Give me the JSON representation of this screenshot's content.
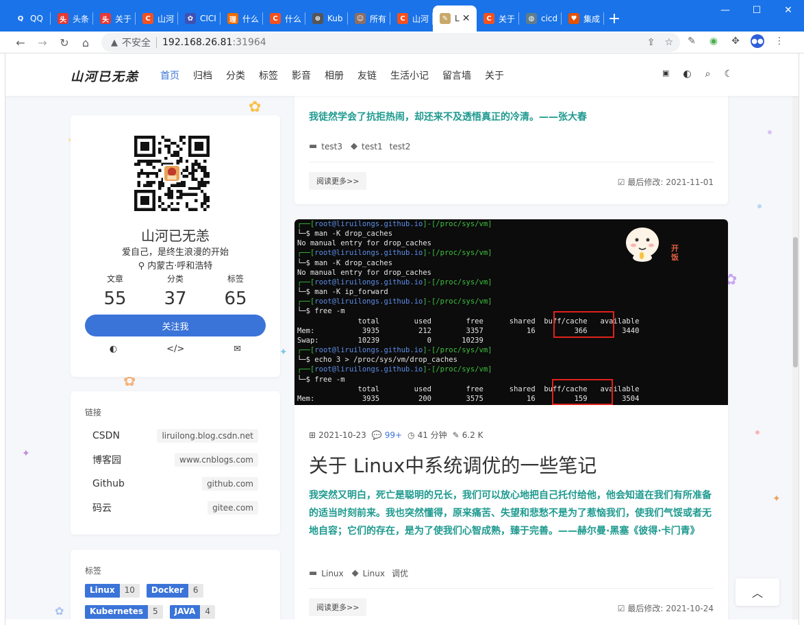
{
  "browser": {
    "tabs": [
      {
        "label": "QQ",
        "color": "#1a73e8",
        "glyph": "Q"
      },
      {
        "label": "头条",
        "color": "#e53935",
        "glyph": "头"
      },
      {
        "label": "关于",
        "color": "#e53935",
        "glyph": "头"
      },
      {
        "label": "山河",
        "color": "#f4511e",
        "glyph": "C"
      },
      {
        "label": "CICI",
        "color": "#3f51b5",
        "glyph": "✿"
      },
      {
        "label": "什么",
        "color": "#ef6c00",
        "glyph": "理"
      },
      {
        "label": "什么",
        "color": "#f4511e",
        "glyph": "C"
      },
      {
        "label": "Kub",
        "color": "#555555",
        "glyph": "⊛"
      },
      {
        "label": "所有",
        "color": "#8d6e63",
        "glyph": "☺"
      },
      {
        "label": "山河",
        "color": "#f4511e",
        "glyph": "C"
      },
      {
        "label": "L",
        "color": "#c9a86a",
        "glyph": "✎"
      },
      {
        "label": "关于",
        "color": "#f4511e",
        "glyph": "C"
      },
      {
        "label": "cicd",
        "color": "#607d8b",
        "glyph": "◍"
      },
      {
        "label": "集成",
        "color": "#e65100",
        "glyph": "♥"
      }
    ],
    "active_tab_index": 10,
    "new_tab": "+",
    "window_controls": {
      "minimize": "—",
      "maximize": "☐",
      "close": "✕"
    },
    "address": {
      "security": "不安全",
      "host": "192.168.26.81",
      "port": ":31964"
    }
  },
  "site": {
    "logo": "山河已无恙",
    "nav": [
      "首页",
      "归档",
      "分类",
      "标签",
      "影音",
      "相册",
      "友链",
      "生活小记",
      "留言墙",
      "关于"
    ],
    "active_nav": "首页"
  },
  "profile": {
    "name": "山河已无恙",
    "motto": "爱自己，是终生浪漫的开始",
    "location": "内蒙古·呼和浩特",
    "stats": [
      {
        "label": "文章",
        "value": "55"
      },
      {
        "label": "分类",
        "value": "37"
      },
      {
        "label": "标签",
        "value": "65"
      }
    ],
    "follow_label": "关注我"
  },
  "links": {
    "title": "链接",
    "items": [
      {
        "name": "CSDN",
        "url": "liruilong.blog.csdn.net"
      },
      {
        "name": "博客园",
        "url": "www.cnblogs.com"
      },
      {
        "name": "Github",
        "url": "github.com"
      },
      {
        "name": "码云",
        "url": "gitee.com"
      }
    ]
  },
  "tags": {
    "title": "标签",
    "items": [
      {
        "name": "Linux",
        "count": "10"
      },
      {
        "name": "Docker",
        "count": "6"
      },
      {
        "name": "Kubernetes",
        "count": "5"
      },
      {
        "name": "JAVA",
        "count": "4"
      }
    ]
  },
  "post1": {
    "quote": "我徒然学会了抗拒热闹，却还来不及透悟真正的冷清。——张大春",
    "category": "test3",
    "tags": [
      "test1",
      "test2"
    ],
    "read_more": "阅读更多>>",
    "modified": "最后修改: 2021-11-01"
  },
  "post2": {
    "date": "2021-10-23",
    "comments": "99+",
    "read_time": "41 分钟",
    "words": "6.2 K",
    "title": "关于 Linux中系统调优的一些笔记",
    "quote": "我突然又明白，死亡是聪明的兄长，我们可以放心地把自己托付给他，他会知道在我们有所准备的适当时刻前来。我也突然懂得，原来痛苦、失望和悲愁不是为了惹恼我们，使我们气馁或者无地自容；它们的存在，是为了使我们心智成熟，臻于完善。——赫尔曼·黑塞《彼得·卡门青》",
    "category": "Linux",
    "tags": [
      "Linux",
      "调优"
    ],
    "read_more": "阅读更多>>",
    "modified": "最后修改: 2021-10-24",
    "emoji_text": "开饭",
    "terminal": [
      {
        "prompt": "┌──[root@liruilongs.github.io]-[/proc/sys/vm]",
        "cmd": "└─$ man -K drop_caches"
      },
      {
        "out": "No manual entry for drop_caches"
      },
      {
        "prompt": "┌──[root@liruilongs.github.io]-[/proc/sys/vm]",
        "cmd": "└─$ man -K drop_caches"
      },
      {
        "out": "No manual entry for drop_caches"
      },
      {
        "prompt": "┌──[root@liruilongs.github.io]-[/proc/sys/vm]",
        "cmd": "└─$ man -K ip_forward"
      },
      {
        "prompt": "┌──[root@liruilongs.github.io]-[/proc/sys/vm]",
        "cmd": "└─$ free -m"
      },
      {
        "out": "              total        used        free      shared  buff/cache   available"
      },
      {
        "out": "Mem:           3935         212        3357          16         366        3440"
      },
      {
        "out": "Swap:         10239           0       10239"
      },
      {
        "prompt": "┌──[root@liruilongs.github.io]-[/proc/sys/vm]",
        "cmd": "└─$ echo 3 > /proc/sys/vm/drop_caches"
      },
      {
        "prompt": "┌──[root@liruilongs.github.io]-[/proc/sys/vm]",
        "cmd": "└─$ free -m"
      },
      {
        "out": "              total        used        free      shared  buff/cache   available"
      },
      {
        "out": "Mem:           3935         200        3575          16         159        3504"
      }
    ]
  },
  "colors": {
    "accent": "#3b74d8",
    "quote": "#1e9a8f",
    "browser": "#1a73e8"
  }
}
